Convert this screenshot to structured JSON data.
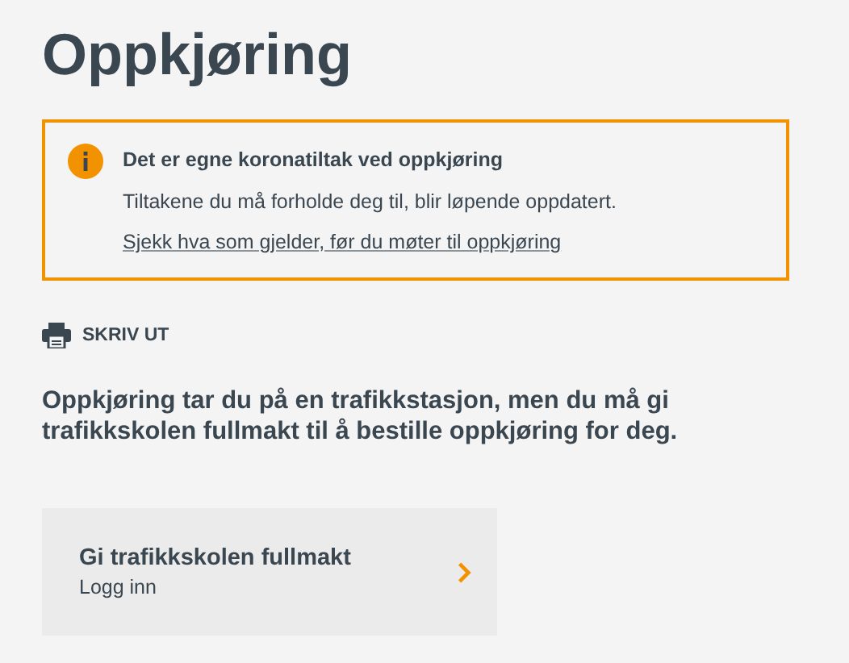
{
  "title": "Oppkjøring",
  "alert": {
    "heading": "Det er egne koronatiltak ved oppkjøring",
    "text": "Tiltakene du må forholde deg til, blir løpende oppdatert.",
    "link": "Sjekk hva som gjelder, før du møter til oppkjøring"
  },
  "print_link": "SKRIV UT",
  "intro": "Oppkjøring tar du på en trafikkstasjon, men du må gi trafikkskolen fullmakt til å bestille oppkjøring for deg.",
  "card": {
    "title": "Gi trafikkskolen fullmakt",
    "subtitle": "Logg inn"
  }
}
